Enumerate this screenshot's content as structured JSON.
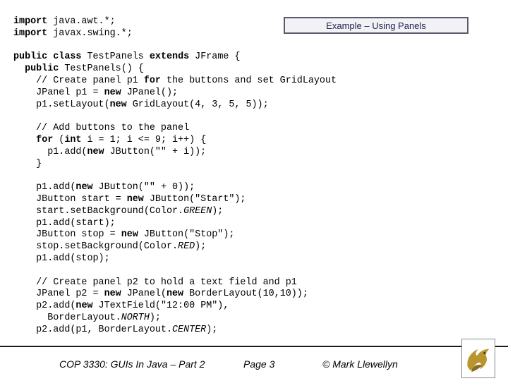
{
  "slide": {
    "title": "Example – Using Panels"
  },
  "code": {
    "l1": "import java.awt.*;",
    "l2": "import javax.swing.*;",
    "l3": "public class TestPanels extends JFrame {",
    "l4": "  public TestPanels() {",
    "l5": "    // Create panel p1 for the buttons and set GridLayout",
    "l6": "    JPanel p1 = new JPanel();",
    "l7": "    p1.setLayout(new GridLayout(4, 3, 5, 5));",
    "l8": "    // Add buttons to the panel",
    "l9": "    for (int i = 1; i <= 9; i++) {",
    "l10": "      p1.add(new JButton(\"\" + i));",
    "l11": "    }",
    "l12": "    p1.add(new JButton(\"\" + 0));",
    "l13": "    JButton start = new JButton(\"Start\");",
    "l14": "    start.setBackground(Color.GREEN);",
    "l15": "    p1.add(start);",
    "l16": "    JButton stop = new JButton(\"Stop\");",
    "l17": "    stop.setBackground(Color.RED);",
    "l18": "    p1.add(stop);",
    "l19": "    // Create panel p2 to hold a text field and p1",
    "l20": "    JPanel p2 = new JPanel(new BorderLayout(10,10));",
    "l21": "    p2.add(new JTextField(\"12:00 PM\"),",
    "l22": "      BorderLayout.NORTH);",
    "l23": "    p2.add(p1, BorderLayout.CENTER);"
  },
  "footer": {
    "course": "COP 3330:  GUIs In Java – Part 2",
    "page": "Page 3",
    "author": "© Mark Llewellyn"
  },
  "logo": {
    "icon": "pegasus-logo-icon",
    "color": "#b8952e"
  }
}
